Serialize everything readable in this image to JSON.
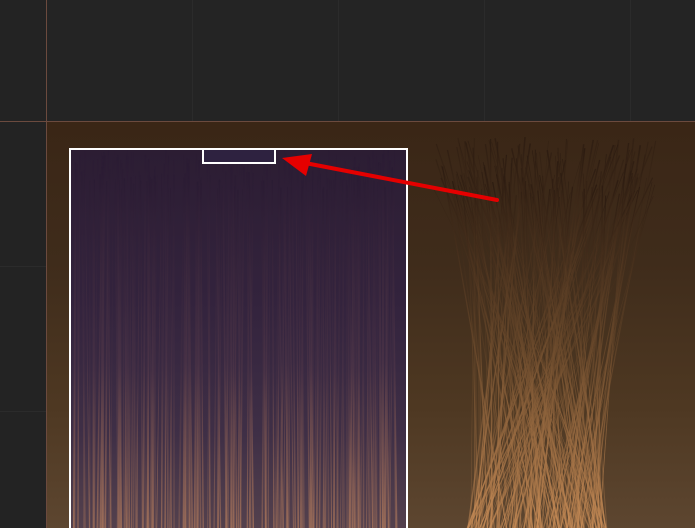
{
  "canvas": {
    "background": "#3f2c1b",
    "hair_left_tint": "#2e2240",
    "hair_right_tint": "#b07a4a"
  },
  "annotation": {
    "arrow_color": "#e50000",
    "selection_border_color": "#ffffff"
  },
  "icons": {
    "arrow": "arrow-icon"
  }
}
